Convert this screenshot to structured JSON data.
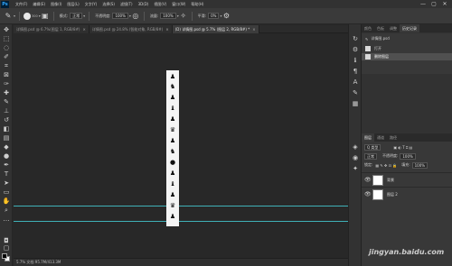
{
  "app": {
    "logo": "Ps",
    "menu": [
      "文件(F)",
      "编辑(E)",
      "图像(I)",
      "图层(L)",
      "文字(Y)",
      "选择(S)",
      "滤镜(T)",
      "3D(D)",
      "视图(V)",
      "窗口(W)",
      "帮助(H)"
    ],
    "window_controls": [
      "—",
      "▢",
      "✕"
    ]
  },
  "options_bar": {
    "brush_size": "300",
    "mode_label": "模式:",
    "mode_value": "正常",
    "opacity_label": "不透明度:",
    "opacity_value": "100%",
    "flow_label": "流量:",
    "flow_value": "100%",
    "smooth_label": "平滑:",
    "smooth_value": "0%"
  },
  "tabs": [
    {
      "label": "详情图.psd @ 6.7%(图层 1, RGB/8#)",
      "active": false
    },
    {
      "label": "详情图.psd @ 24.8% (智能对象, RGB/8#)",
      "active": false
    },
    {
      "label": "(D) 详情图.psd @ 5.7% (图层 2, RGB/8#) *",
      "active": true
    }
  ],
  "status": "5.7%    文档:95.7M/413.3M",
  "right_panels": {
    "top_tabs": [
      "颜色",
      "色板",
      "调整",
      "历史记录"
    ],
    "history_title": "详情图.psd",
    "history_items": [
      {
        "label": "打开",
        "selected": false
      },
      {
        "label": "删除图层",
        "selected": true
      }
    ],
    "layers_tabs": [
      "图层",
      "通道",
      "路径"
    ],
    "filter_label": "Q 类型",
    "blend_mode": "正常",
    "opacity_label": "不透明度:",
    "opacity_value": "100%",
    "lock_label": "锁定:",
    "fill_label": "填充:",
    "fill_value": "100%",
    "layers": [
      {
        "name": "背景"
      },
      {
        "name": "图层 2"
      }
    ]
  },
  "watermark": "jingyan.baidu.com",
  "colors": {
    "guide": "#3fb1b8",
    "canvas": "#282828",
    "panel": "#323232"
  }
}
